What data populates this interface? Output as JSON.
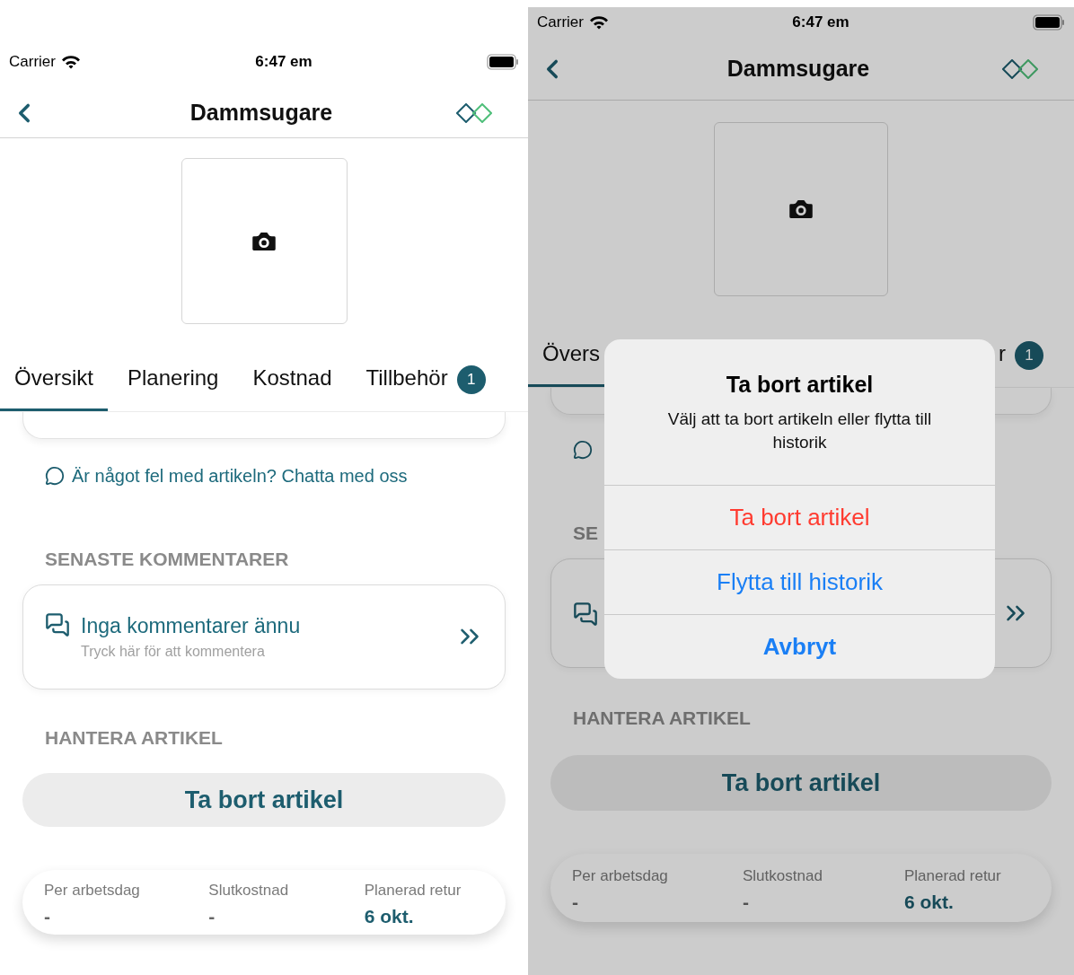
{
  "screens": [
    {
      "dimmed": false,
      "status_bar": {
        "carrier": "Carrier",
        "time": "6:47 em"
      },
      "nav": {
        "title": "Dammsugare"
      },
      "tabs": [
        {
          "label": "Översikt",
          "selected": true
        },
        {
          "label": "Planering",
          "selected": false
        },
        {
          "label": "Kostnad",
          "selected": false
        },
        {
          "label": "Tillbehör",
          "selected": false,
          "badge": "1"
        }
      ],
      "chat_link": {
        "text": "Är något fel med artikeln? Chatta med oss"
      },
      "comments": {
        "heading": "SENASTE KOMMENTARER",
        "title": "Inga kommentarer ännu",
        "hint": "Tryck här för att kommentera"
      },
      "manage": {
        "heading": "HANTERA ARTIKEL",
        "button": "Ta bort artikel"
      },
      "summary": [
        {
          "label": "Per arbetsdag",
          "value": "-",
          "highlight": false
        },
        {
          "label": "Slutkostnad",
          "value": "-",
          "highlight": false
        },
        {
          "label": "Planerad retur",
          "value": "6 okt.",
          "highlight": true
        }
      ]
    },
    {
      "dimmed": true,
      "status_bar": {
        "carrier": "Carrier",
        "time": "6:47 em"
      },
      "nav": {
        "title": "Dammsugare"
      },
      "tabs": [
        {
          "label": "Övers",
          "selected": true
        },
        {
          "label": "r",
          "selected": false,
          "badge": "1"
        }
      ],
      "comments": {
        "heading": "SE"
      },
      "manage": {
        "heading": "HANTERA ARTIKEL",
        "button": "Ta bort artikel"
      },
      "summary": [
        {
          "label": "Per arbetsdag",
          "value": "-",
          "highlight": false
        },
        {
          "label": "Slutkostnad",
          "value": "-",
          "highlight": false
        },
        {
          "label": "Planerad retur",
          "value": "6 okt.",
          "highlight": true
        }
      ],
      "dialog": {
        "title": "Ta bort artikel",
        "message": "Välj att ta bort artikeln eller flytta till historik",
        "actions": [
          {
            "label": "Ta bort artikel",
            "kind": "destructive"
          },
          {
            "label": "Flytta till historik",
            "kind": "default"
          },
          {
            "label": "Avbryt",
            "kind": "cancel"
          }
        ]
      }
    }
  ]
}
